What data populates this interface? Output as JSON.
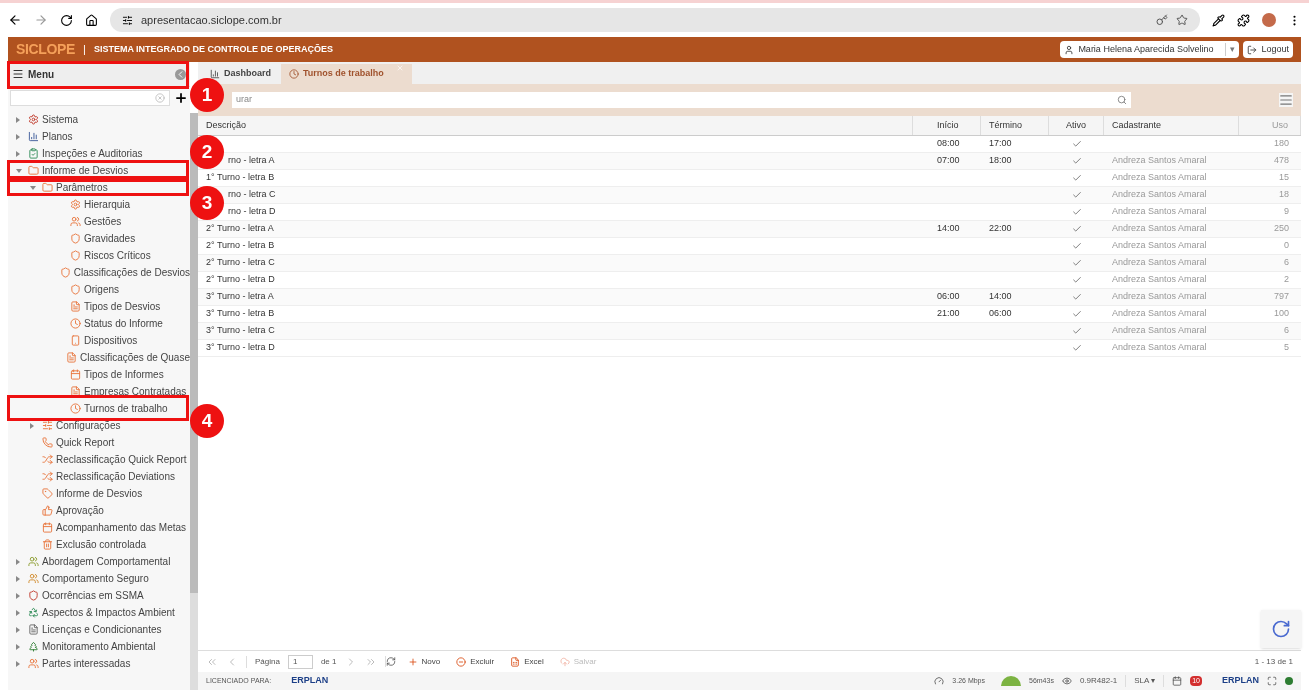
{
  "browser": {
    "url": "apresentacao.siclope.com.br"
  },
  "header": {
    "logo": "SICLOPE",
    "separator": "|",
    "caret": "▾",
    "title": "SISTEMA INTEGRADO DE CONTROLE DE OPERAÇÕES",
    "user": "Maria Helena Aparecida Solvelino",
    "logout": "Logout"
  },
  "sidebar": {
    "title": "Menu",
    "items": [
      {
        "label": "Sistema",
        "expanded": false
      },
      {
        "label": "Planos",
        "expanded": false
      },
      {
        "label": "Inspeções e Auditorias",
        "expanded": false
      },
      {
        "label": "Informe de Desvios",
        "expanded": true,
        "children": [
          {
            "label": "Parâmetros",
            "expanded": true,
            "children": [
              {
                "label": "Hierarquia"
              },
              {
                "label": "Gestões"
              },
              {
                "label": "Gravidades"
              },
              {
                "label": "Riscos Críticos"
              },
              {
                "label": "Classificações de Desvios"
              },
              {
                "label": "Origens"
              },
              {
                "label": "Tipos de Desvios"
              },
              {
                "label": "Status do Informe"
              },
              {
                "label": "Dispositivos"
              },
              {
                "label": "Classificações de Quase"
              },
              {
                "label": "Tipos de Informes"
              },
              {
                "label": "Empresas Contratadas"
              },
              {
                "label": "Turnos de trabalho"
              }
            ]
          },
          {
            "label": "Configurações",
            "expanded": false
          },
          {
            "label": "Quick Report"
          },
          {
            "label": "Reclassificação Quick Report"
          },
          {
            "label": "Reclassificação Deviations"
          },
          {
            "label": "Informe de Desvios"
          },
          {
            "label": "Aprovação"
          },
          {
            "label": "Acompanhamento das Metas"
          },
          {
            "label": "Exclusão controlada"
          }
        ]
      },
      {
        "label": "Abordagem Comportamental",
        "expanded": false
      },
      {
        "label": "Comportamento Seguro",
        "expanded": false
      },
      {
        "label": "Ocorrências em SSMA",
        "expanded": false
      },
      {
        "label": "Aspectos & Impactos Ambient",
        "expanded": false
      },
      {
        "label": "Licenças e Condicionantes",
        "expanded": false
      },
      {
        "label": "Monitoramento Ambiental",
        "expanded": false
      },
      {
        "label": "Partes interessadas",
        "expanded": false
      }
    ]
  },
  "tabs": [
    {
      "label": "Dashboard",
      "selected": false
    },
    {
      "label": "Turnos de trabalho",
      "selected": true
    }
  ],
  "search": {
    "placeholder": "urar"
  },
  "table": {
    "columns": [
      "Descrição",
      "Início",
      "Término",
      "Ativo",
      "Cadastrante",
      "Uso"
    ],
    "rows": [
      {
        "start": "08:00",
        "end": "17:00",
        "active": true,
        "use": "180"
      },
      {
        "description": "rno - letra A",
        "start": "07:00",
        "end": "18:00",
        "active": true,
        "author": "Andreza Santos Amaral",
        "use": "478"
      },
      {
        "description": "1° Turno - letra B",
        "active": true,
        "author": "Andreza Santos Amaral",
        "use": "15"
      },
      {
        "description": "rno - letra C",
        "active": true,
        "author": "Andreza Santos Amaral",
        "use": "18"
      },
      {
        "description": "rno - letra D",
        "active": true,
        "author": "Andreza Santos Amaral",
        "use": "9"
      },
      {
        "description": "2° Turno - letra A",
        "start": "14:00",
        "end": "22:00",
        "active": true,
        "author": "Andreza Santos Amaral",
        "use": "250"
      },
      {
        "description": "2° Turno - letra B",
        "active": true,
        "author": "Andreza Santos Amaral",
        "use": "0"
      },
      {
        "description": "2° Turno - letra C",
        "active": true,
        "author": "Andreza Santos Amaral",
        "use": "6"
      },
      {
        "description": "2° Turno - letra D",
        "active": true,
        "author": "Andreza Santos Amaral",
        "use": "2"
      },
      {
        "description": "3° Turno - letra A",
        "start": "06:00",
        "end": "14:00",
        "active": true,
        "author": "Andreza Santos Amaral",
        "use": "797"
      },
      {
        "description": "3° Turno - letra B",
        "start": "21:00",
        "end": "06:00",
        "active": true,
        "author": "Andreza Santos Amaral",
        "use": "100"
      },
      {
        "description": "3° Turno - letra C",
        "active": true,
        "author": "Andreza Santos Amaral",
        "use": "6"
      },
      {
        "description": "3° Turno - letra D",
        "active": true,
        "author": "Andreza Santos Amaral",
        "use": "5"
      }
    ]
  },
  "pager": {
    "page_label": "Página",
    "page": "1",
    "of": "de 1",
    "actions": [
      {
        "label": "Novo",
        "disabled": false
      },
      {
        "label": "Excluir",
        "disabled": false
      },
      {
        "label": "Excel",
        "disabled": false
      },
      {
        "label": "Salvar",
        "disabled": true
      }
    ],
    "count": "1 - 13 de 1"
  },
  "status_bar": {
    "licensed": "LICENCIADO PARA:",
    "brand": "ERPLAN",
    "speed": "3.26 Mbps",
    "session": "56m43s",
    "version": "0.9R482-1",
    "sla": "SLA",
    "sla_caret": "▾",
    "badge": "10",
    "brand_right": "ERPLAN"
  },
  "annotations": [
    {
      "number": "1"
    },
    {
      "number": "2"
    },
    {
      "number": "3"
    },
    {
      "number": "4"
    }
  ]
}
